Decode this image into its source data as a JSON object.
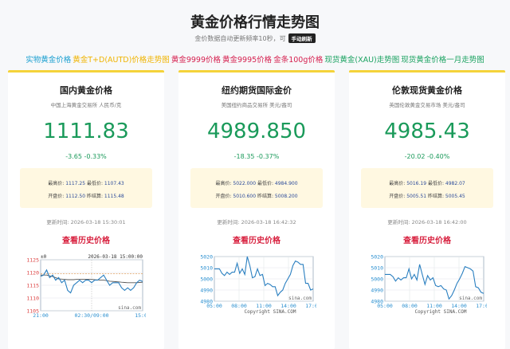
{
  "header": {
    "title": "黄金价格行情走势图",
    "subtitle": "金价数据自动更新频率10秒，可",
    "refresh_label": "手动刷新"
  },
  "links": [
    {
      "label": "实物黄金价格",
      "color": "#1a9fd0"
    },
    {
      "label": "黄金T+D(AUTD)价格走势图",
      "color": "#f0b400"
    },
    {
      "label": "黄金9999价格",
      "color": "#d6204f"
    },
    {
      "label": "黄金9995价格",
      "color": "#d6204f"
    },
    {
      "label": "金条100g价格",
      "color": "#d6204f"
    },
    {
      "label": "现货黄金(XAU)走势图",
      "color": "#1aa260"
    },
    {
      "label": "现货黄金价格一月走势图",
      "color": "#1aa260"
    }
  ],
  "cards": [
    {
      "title": "国内黄金价格",
      "source": "中国上海黄金交易所 人民币/克",
      "price": "1111.83",
      "change": "-3.65  -0.33%",
      "high_label": "最高价:",
      "high": "1117.25",
      "low_label": "最低价:",
      "low": "1107.43",
      "open_label": "开盘价:",
      "open": "1112.50",
      "prev_label": "昨结算:",
      "prev": "1115.48",
      "updated": "更新时间: 2026-03-18 15:30:01",
      "history_label": "查看历史价格"
    },
    {
      "title": "纽约期货国际金价",
      "source": "美国纽约商品交易所 美元/盎司",
      "price": "4989.850",
      "change": "-18.35  -0.37%",
      "high_label": "最高价:",
      "high": "5022.000",
      "low_label": "最低价:",
      "low": "4984.900",
      "open_label": "开盘价:",
      "open": "5010.600",
      "prev_label": "昨结算:",
      "prev": "5008.200",
      "updated": "更新时间: 2026-03-18 16:42:32",
      "history_label": "查看历史价格"
    },
    {
      "title": "伦敦现货黄金价格",
      "source": "英国伦敦黄金交易市场 美元/盎司",
      "price": "4985.43",
      "change": "-20.02  -0.40%",
      "high_label": "最高价:",
      "high": "5016.19",
      "low_label": "最低价:",
      "low": "4982.07",
      "open_label": "开盘价:",
      "open": "5005.51",
      "prev_label": "昨结算:",
      "prev": "5005.45",
      "updated": "更新时间: 2026-03-18 16:42:00",
      "history_label": "查看历史价格"
    }
  ],
  "chart_data": [
    {
      "type": "line",
      "header_left": "±0",
      "header_right": "2026-03-18 15:00:00",
      "ylim": [
        1105,
        1125
      ],
      "yticks": [
        "1125",
        "1120",
        "1115",
        "1110",
        "1105"
      ],
      "xticks": [
        "21:00",
        "02:30/09:00",
        "15:00"
      ],
      "watermark": "sina.com",
      "reference": 1119.5,
      "values": [
        1118.5,
        1119,
        1121,
        1118,
        1119,
        1117,
        1118,
        1116,
        1117,
        1113,
        1112,
        1115,
        1116,
        1117,
        1116,
        1117,
        1117,
        1116,
        1117,
        1117,
        1118,
        1119,
        1117,
        1115,
        1116,
        1116,
        1116,
        1114,
        1113,
        1114,
        1113,
        1114,
        1116,
        1117,
        1116.5
      ],
      "avg": [
        1119,
        1119,
        1119,
        1118.7,
        1118.4,
        1118,
        1117.5,
        1117.4,
        1117.3,
        1117.2,
        1117.2,
        1117.2,
        1117.3,
        1117.3,
        1117.3,
        1117.3,
        1117.3,
        1117.3,
        1117.2,
        1117.1,
        1117,
        1117,
        1116.8,
        1116.6,
        1116.5,
        1116.4,
        1116.3,
        1116.2,
        1116.1,
        1116,
        1116,
        1116,
        1116,
        1116.1,
        1116.2
      ]
    },
    {
      "type": "line",
      "ylim": [
        4980,
        5020
      ],
      "yticks": [
        "5020",
        "5010",
        "5000",
        "4990",
        "4980"
      ],
      "xticks": [
        "05:00",
        "08:00",
        "11:00",
        "14:00",
        "17:00"
      ],
      "watermark": "sina.com",
      "footer": "Copyright  SINA.COM",
      "values": [
        5009,
        5009,
        5009,
        5005,
        5003,
        5006,
        5004,
        5006,
        5006,
        5014,
        5005,
        5009,
        5004,
        5020,
        5012,
        5001,
        5002,
        5009,
        5003,
        5004,
        4994,
        4996,
        4995,
        4993,
        4993,
        4985,
        4988,
        4990,
        4996,
        5000,
        5004,
        5012,
        5016,
        5015,
        5013,
        5013,
        4996,
        4996,
        4990,
        4991
      ],
      "legend": false
    },
    {
      "type": "line",
      "ylim": [
        4980,
        5020
      ],
      "yticks": [
        "5020",
        "5010",
        "5000",
        "4990",
        "4980"
      ],
      "xticks": [
        "05:00",
        "08:00",
        "11:00",
        "14:00",
        "17:00"
      ],
      "watermark": "sina.com",
      "footer": "Copyright  SINA.COM",
      "values": [
        5004,
        5004,
        5004,
        5002,
        4998,
        5001,
        4999,
        5001,
        5001,
        5009,
        5000,
        5004,
        4999,
        5013,
        5004,
        4995,
        5003,
        4999,
        5001,
        4994,
        4993,
        4994,
        4991,
        4990,
        4982,
        4985,
        4990,
        4996,
        5000,
        5005,
        5011,
        5010,
        5009,
        5007,
        4993,
        4992,
        4988,
        4987
      ]
    }
  ]
}
